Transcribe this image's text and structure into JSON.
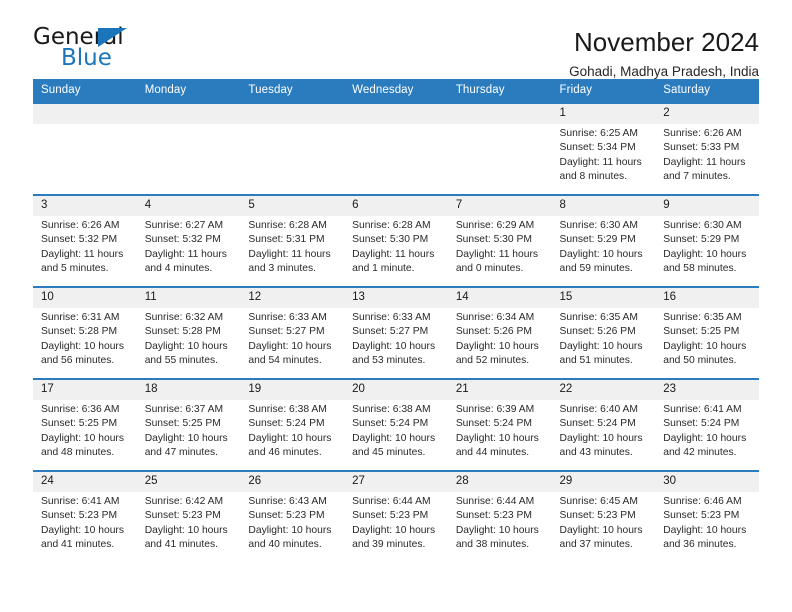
{
  "logo": {
    "word_one": "General",
    "word_two": "Blue",
    "triangle_icon": "triangle-icon",
    "accent_color": "#1b75bb"
  },
  "header": {
    "title": "November 2024",
    "subtitle": "Gohadi, Madhya Pradesh, India"
  },
  "calendar": {
    "header_bg": "#2b7cbf",
    "day_band_bg": "#f0f0f0",
    "weekday_headers": [
      "Sunday",
      "Monday",
      "Tuesday",
      "Wednesday",
      "Thursday",
      "Friday",
      "Saturday"
    ],
    "weeks": [
      [
        {
          "day": "",
          "sunrise": "",
          "sunset": "",
          "daylight_line1": "",
          "daylight_line2": "",
          "empty": true
        },
        {
          "day": "",
          "sunrise": "",
          "sunset": "",
          "daylight_line1": "",
          "daylight_line2": "",
          "empty": true
        },
        {
          "day": "",
          "sunrise": "",
          "sunset": "",
          "daylight_line1": "",
          "daylight_line2": "",
          "empty": true
        },
        {
          "day": "",
          "sunrise": "",
          "sunset": "",
          "daylight_line1": "",
          "daylight_line2": "",
          "empty": true
        },
        {
          "day": "",
          "sunrise": "",
          "sunset": "",
          "daylight_line1": "",
          "daylight_line2": "",
          "empty": true
        },
        {
          "day": "1",
          "sunrise": "Sunrise: 6:25 AM",
          "sunset": "Sunset: 5:34 PM",
          "daylight_line1": "Daylight: 11 hours",
          "daylight_line2": "and 8 minutes."
        },
        {
          "day": "2",
          "sunrise": "Sunrise: 6:26 AM",
          "sunset": "Sunset: 5:33 PM",
          "daylight_line1": "Daylight: 11 hours",
          "daylight_line2": "and 7 minutes."
        }
      ],
      [
        {
          "day": "3",
          "sunrise": "Sunrise: 6:26 AM",
          "sunset": "Sunset: 5:32 PM",
          "daylight_line1": "Daylight: 11 hours",
          "daylight_line2": "and 5 minutes."
        },
        {
          "day": "4",
          "sunrise": "Sunrise: 6:27 AM",
          "sunset": "Sunset: 5:32 PM",
          "daylight_line1": "Daylight: 11 hours",
          "daylight_line2": "and 4 minutes."
        },
        {
          "day": "5",
          "sunrise": "Sunrise: 6:28 AM",
          "sunset": "Sunset: 5:31 PM",
          "daylight_line1": "Daylight: 11 hours",
          "daylight_line2": "and 3 minutes."
        },
        {
          "day": "6",
          "sunrise": "Sunrise: 6:28 AM",
          "sunset": "Sunset: 5:30 PM",
          "daylight_line1": "Daylight: 11 hours",
          "daylight_line2": "and 1 minute."
        },
        {
          "day": "7",
          "sunrise": "Sunrise: 6:29 AM",
          "sunset": "Sunset: 5:30 PM",
          "daylight_line1": "Daylight: 11 hours",
          "daylight_line2": "and 0 minutes."
        },
        {
          "day": "8",
          "sunrise": "Sunrise: 6:30 AM",
          "sunset": "Sunset: 5:29 PM",
          "daylight_line1": "Daylight: 10 hours",
          "daylight_line2": "and 59 minutes."
        },
        {
          "day": "9",
          "sunrise": "Sunrise: 6:30 AM",
          "sunset": "Sunset: 5:29 PM",
          "daylight_line1": "Daylight: 10 hours",
          "daylight_line2": "and 58 minutes."
        }
      ],
      [
        {
          "day": "10",
          "sunrise": "Sunrise: 6:31 AM",
          "sunset": "Sunset: 5:28 PM",
          "daylight_line1": "Daylight: 10 hours",
          "daylight_line2": "and 56 minutes."
        },
        {
          "day": "11",
          "sunrise": "Sunrise: 6:32 AM",
          "sunset": "Sunset: 5:28 PM",
          "daylight_line1": "Daylight: 10 hours",
          "daylight_line2": "and 55 minutes."
        },
        {
          "day": "12",
          "sunrise": "Sunrise: 6:33 AM",
          "sunset": "Sunset: 5:27 PM",
          "daylight_line1": "Daylight: 10 hours",
          "daylight_line2": "and 54 minutes."
        },
        {
          "day": "13",
          "sunrise": "Sunrise: 6:33 AM",
          "sunset": "Sunset: 5:27 PM",
          "daylight_line1": "Daylight: 10 hours",
          "daylight_line2": "and 53 minutes."
        },
        {
          "day": "14",
          "sunrise": "Sunrise: 6:34 AM",
          "sunset": "Sunset: 5:26 PM",
          "daylight_line1": "Daylight: 10 hours",
          "daylight_line2": "and 52 minutes."
        },
        {
          "day": "15",
          "sunrise": "Sunrise: 6:35 AM",
          "sunset": "Sunset: 5:26 PM",
          "daylight_line1": "Daylight: 10 hours",
          "daylight_line2": "and 51 minutes."
        },
        {
          "day": "16",
          "sunrise": "Sunrise: 6:35 AM",
          "sunset": "Sunset: 5:25 PM",
          "daylight_line1": "Daylight: 10 hours",
          "daylight_line2": "and 50 minutes."
        }
      ],
      [
        {
          "day": "17",
          "sunrise": "Sunrise: 6:36 AM",
          "sunset": "Sunset: 5:25 PM",
          "daylight_line1": "Daylight: 10 hours",
          "daylight_line2": "and 48 minutes."
        },
        {
          "day": "18",
          "sunrise": "Sunrise: 6:37 AM",
          "sunset": "Sunset: 5:25 PM",
          "daylight_line1": "Daylight: 10 hours",
          "daylight_line2": "and 47 minutes."
        },
        {
          "day": "19",
          "sunrise": "Sunrise: 6:38 AM",
          "sunset": "Sunset: 5:24 PM",
          "daylight_line1": "Daylight: 10 hours",
          "daylight_line2": "and 46 minutes."
        },
        {
          "day": "20",
          "sunrise": "Sunrise: 6:38 AM",
          "sunset": "Sunset: 5:24 PM",
          "daylight_line1": "Daylight: 10 hours",
          "daylight_line2": "and 45 minutes."
        },
        {
          "day": "21",
          "sunrise": "Sunrise: 6:39 AM",
          "sunset": "Sunset: 5:24 PM",
          "daylight_line1": "Daylight: 10 hours",
          "daylight_line2": "and 44 minutes."
        },
        {
          "day": "22",
          "sunrise": "Sunrise: 6:40 AM",
          "sunset": "Sunset: 5:24 PM",
          "daylight_line1": "Daylight: 10 hours",
          "daylight_line2": "and 43 minutes."
        },
        {
          "day": "23",
          "sunrise": "Sunrise: 6:41 AM",
          "sunset": "Sunset: 5:24 PM",
          "daylight_line1": "Daylight: 10 hours",
          "daylight_line2": "and 42 minutes."
        }
      ],
      [
        {
          "day": "24",
          "sunrise": "Sunrise: 6:41 AM",
          "sunset": "Sunset: 5:23 PM",
          "daylight_line1": "Daylight: 10 hours",
          "daylight_line2": "and 41 minutes."
        },
        {
          "day": "25",
          "sunrise": "Sunrise: 6:42 AM",
          "sunset": "Sunset: 5:23 PM",
          "daylight_line1": "Daylight: 10 hours",
          "daylight_line2": "and 41 minutes."
        },
        {
          "day": "26",
          "sunrise": "Sunrise: 6:43 AM",
          "sunset": "Sunset: 5:23 PM",
          "daylight_line1": "Daylight: 10 hours",
          "daylight_line2": "and 40 minutes."
        },
        {
          "day": "27",
          "sunrise": "Sunrise: 6:44 AM",
          "sunset": "Sunset: 5:23 PM",
          "daylight_line1": "Daylight: 10 hours",
          "daylight_line2": "and 39 minutes."
        },
        {
          "day": "28",
          "sunrise": "Sunrise: 6:44 AM",
          "sunset": "Sunset: 5:23 PM",
          "daylight_line1": "Daylight: 10 hours",
          "daylight_line2": "and 38 minutes."
        },
        {
          "day": "29",
          "sunrise": "Sunrise: 6:45 AM",
          "sunset": "Sunset: 5:23 PM",
          "daylight_line1": "Daylight: 10 hours",
          "daylight_line2": "and 37 minutes."
        },
        {
          "day": "30",
          "sunrise": "Sunrise: 6:46 AM",
          "sunset": "Sunset: 5:23 PM",
          "daylight_line1": "Daylight: 10 hours",
          "daylight_line2": "and 36 minutes."
        }
      ]
    ]
  }
}
